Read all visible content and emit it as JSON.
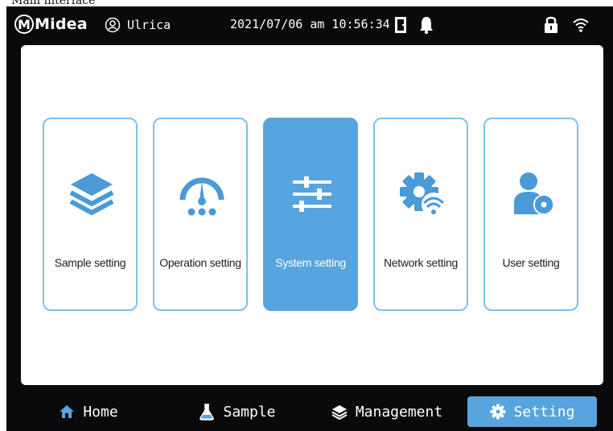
{
  "caption": "Main interface",
  "status_bar": {
    "logo": "Midea",
    "user_name": "Ulrica",
    "datetime": "2021/07/06 am 10:56:34",
    "icons": [
      "user-icon",
      "door-icon",
      "bell-icon",
      "lock-icon",
      "wifi-icon"
    ]
  },
  "settings_cards": [
    {
      "label": "Sample setting",
      "icon": "layers-icon",
      "active": false
    },
    {
      "label": "Operation setting",
      "icon": "gauge-icon",
      "active": false
    },
    {
      "label": "System setting",
      "icon": "sliders-icon",
      "active": true
    },
    {
      "label": "Network setting",
      "icon": "network-gear-icon",
      "active": false
    },
    {
      "label": "User setting",
      "icon": "user-gear-icon",
      "active": false
    }
  ],
  "bottom_nav": [
    {
      "label": "Home",
      "icon": "home-icon",
      "active": false
    },
    {
      "label": "Sample",
      "icon": "flask-icon",
      "active": false
    },
    {
      "label": "Management",
      "icon": "layers-icon",
      "active": false
    },
    {
      "label": "Setting",
      "icon": "gear-icon",
      "active": true
    }
  ],
  "colors": {
    "background": "#0a0a0d",
    "accent": "#58a4de",
    "card_border": "#7cc0ee",
    "icon_blue": "#4a9ad8"
  }
}
